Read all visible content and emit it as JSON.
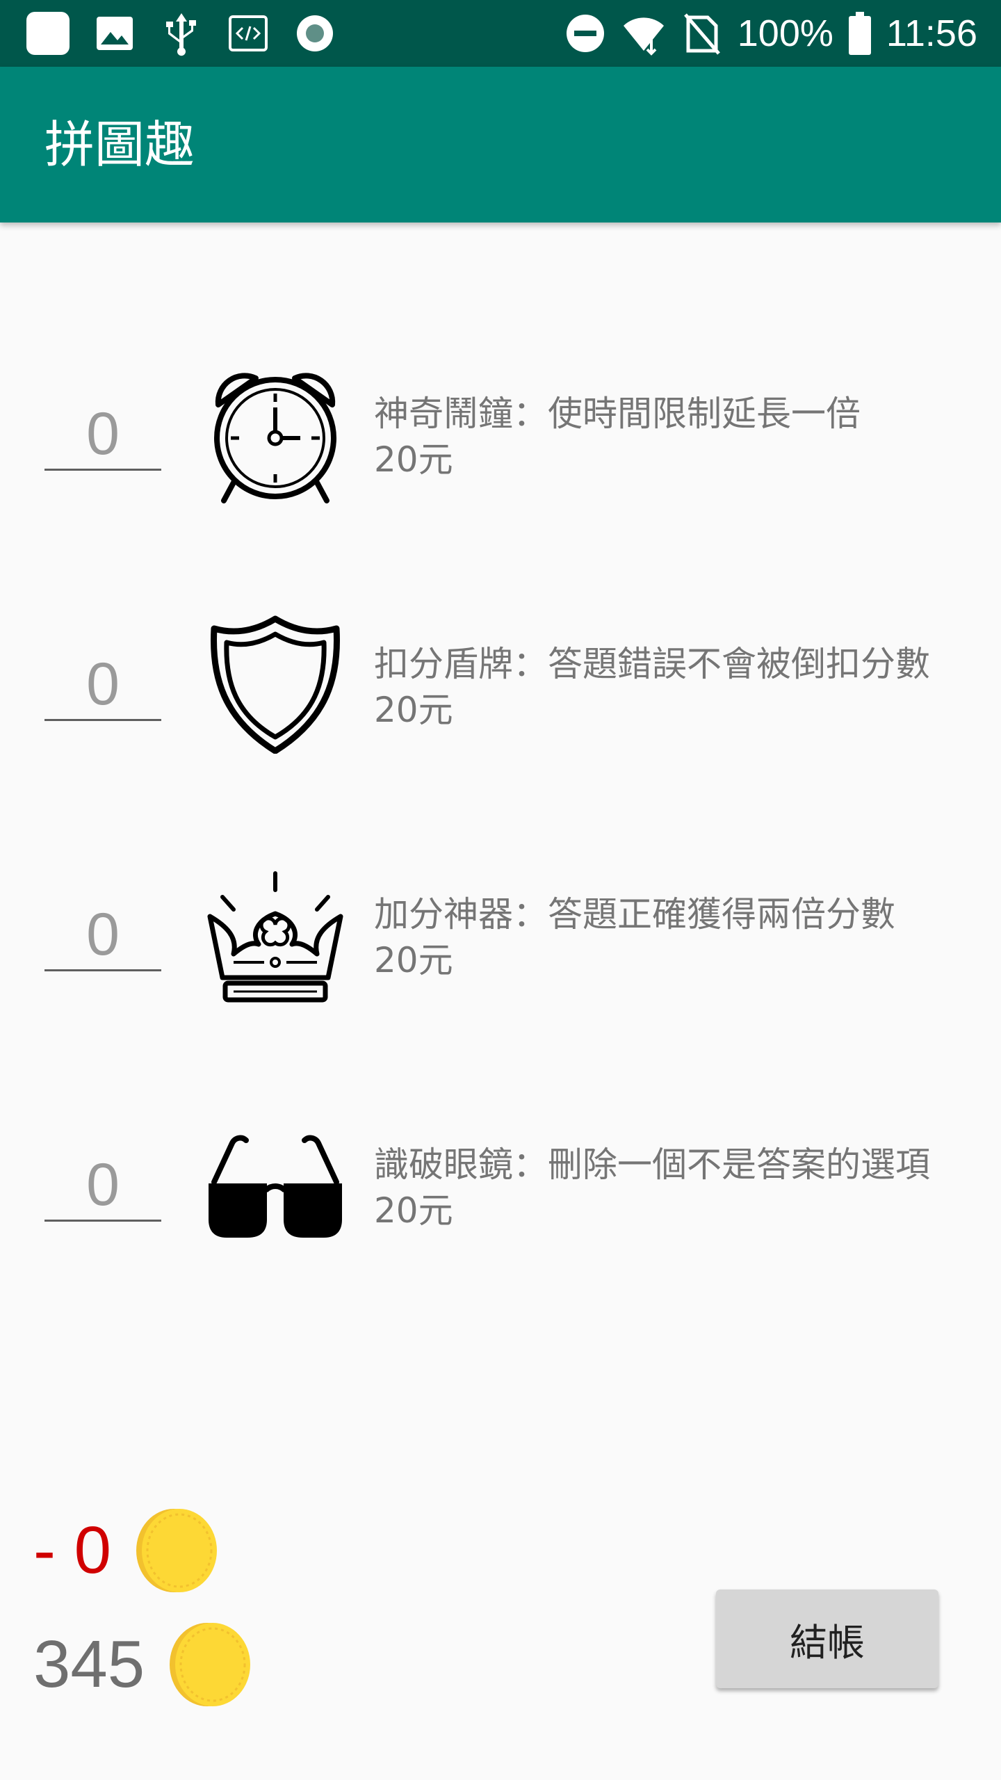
{
  "status_bar": {
    "battery_percent": "100%",
    "time": "11:56",
    "icons": [
      "app-icon",
      "image-icon",
      "usb-icon",
      "code-icon",
      "record-icon",
      "dnd-icon",
      "wifi-icon",
      "no-sim-icon",
      "battery-icon"
    ]
  },
  "app_bar": {
    "title": "拼圖趣"
  },
  "items": [
    {
      "qty": "0",
      "icon": "alarm-clock-icon",
      "desc": "神奇鬧鐘：使時間限制延長一倍",
      "price": "20元"
    },
    {
      "qty": "0",
      "icon": "shield-icon",
      "desc": "扣分盾牌：答題錯誤不會被倒扣分數",
      "price": "20元"
    },
    {
      "qty": "0",
      "icon": "crown-icon",
      "desc": "加分神器：答題正確獲得兩倍分數",
      "price": "20元"
    },
    {
      "qty": "0",
      "icon": "sunglasses-icon",
      "desc": "識破眼鏡：刪除一個不是答案的選項",
      "price": "20元"
    }
  ],
  "summary": {
    "cost": "- 0",
    "balance": "345",
    "cost_color": "#d00000",
    "coin_icon": "coin-icon"
  },
  "checkout_label": "結帳",
  "colors": {
    "status_bar": "#00574b",
    "app_bar": "#008577",
    "background": "#fafafa"
  }
}
